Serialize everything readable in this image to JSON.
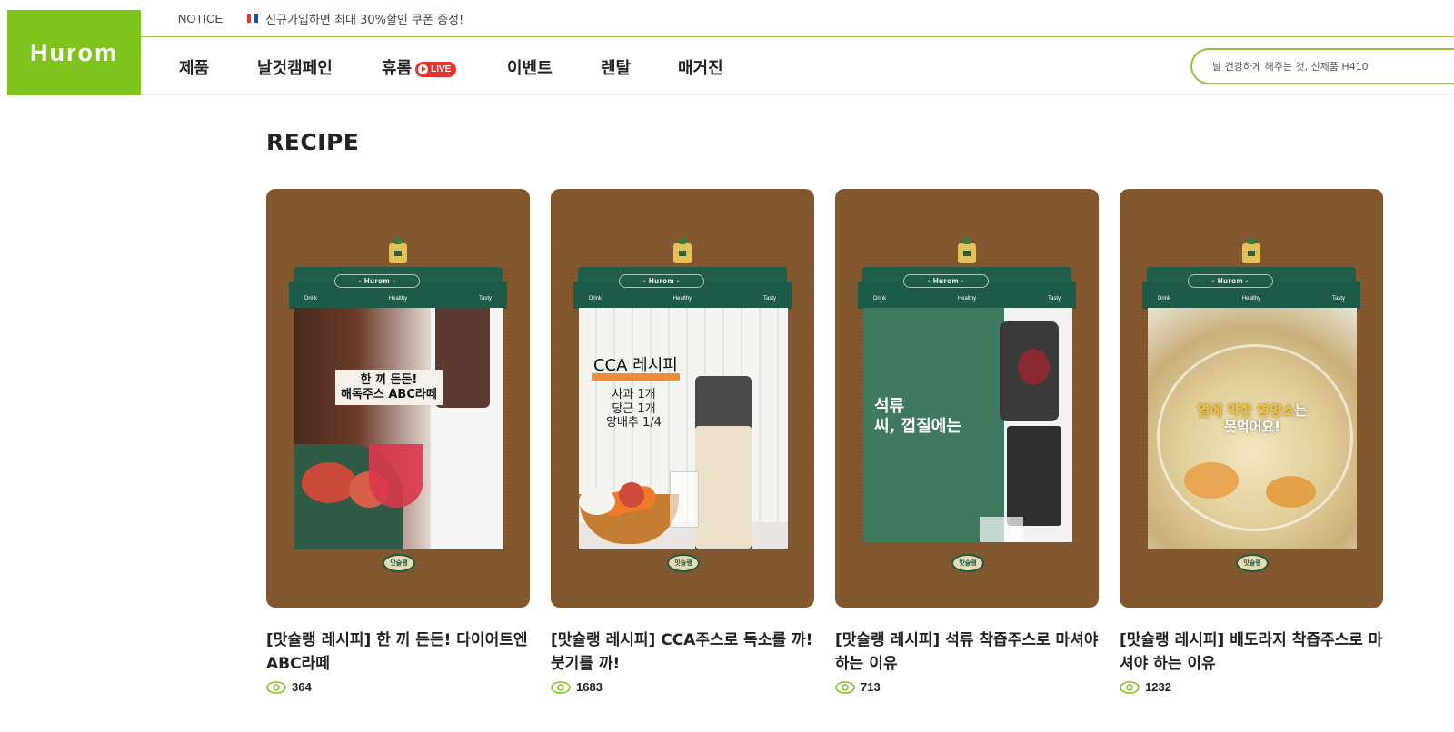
{
  "brand": {
    "logo_text": "Hurom",
    "accent_color": "#7fc31f"
  },
  "notice": {
    "label": "NOTICE",
    "flag_icon": "korea-flag-icon",
    "text": "신규가입하면 최대 30%할인 쿠폰 증정!"
  },
  "nav": {
    "items": [
      {
        "label": "제품"
      },
      {
        "label": "날것캠페인"
      },
      {
        "label": "휴롬",
        "badge": "LIVE"
      },
      {
        "label": "이벤트"
      },
      {
        "label": "렌탈"
      },
      {
        "label": "매거진"
      }
    ]
  },
  "search": {
    "placeholder": "날 건강하게 해주는 것, 신제품 H410"
  },
  "section": {
    "title": "RECIPE"
  },
  "awning": {
    "brand": "· Hurom ·",
    "left": "Drink",
    "center": "Healthy",
    "right": "Tasty",
    "badge": "맛슐랭"
  },
  "cards": [
    {
      "title": "[맛슐랭 레시피] 한 끼 든든! 다이어트엔 ABC라떼",
      "title_icon": "apple-icon",
      "views": "364",
      "photo_text": "한 끼 든든!\n해독주스 ABC라떼"
    },
    {
      "title": "[맛슐랭 레시피] CCA주스로 독소를 까! 붓기를 까!",
      "views": "1683",
      "photo_heading": "CCA 레시피",
      "photo_text": "사과 1개\n당근 1개\n양배추 1/4"
    },
    {
      "title": "[맛슐랭 레시피] 석류 착즙주스로 마셔야 하는 이유",
      "views": "713",
      "photo_text": "석류\n씨, 껍질에는"
    },
    {
      "title": "[맛슐랭 레시피] 배도라지 착즙주스로 마셔야 하는 이유",
      "views": "1232",
      "photo_highlight": "열에 약한 영양소",
      "photo_suffix": "는",
      "photo_text": "못먹어요!"
    }
  ]
}
